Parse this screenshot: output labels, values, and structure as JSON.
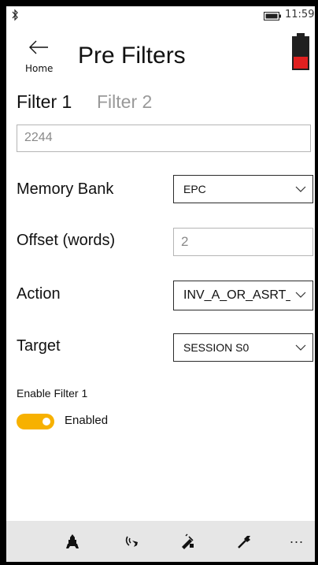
{
  "status_bar": {
    "time": "11:59",
    "icons": [
      "bluetooth-icon",
      "battery-icon"
    ]
  },
  "header": {
    "back_label": "Home",
    "back_icon": "back-arrow-icon",
    "title": "Pre Filters",
    "reader_battery": {
      "icon": "reader-battery-icon",
      "level": 0.3,
      "color": "#e02020"
    }
  },
  "tabs": [
    {
      "label": "Filter 1",
      "selected": true
    },
    {
      "label": "Filter 2",
      "selected": false
    }
  ],
  "filter": {
    "tag_mask_value": "2244",
    "memory_bank": {
      "label": "Memory Bank",
      "value": "EPC"
    },
    "offset": {
      "label": "Offset (words)",
      "value": "2"
    },
    "action": {
      "label": "Action",
      "value": "INV_A_OR_ASRT_SL"
    },
    "target": {
      "label": "Target",
      "value": "SESSION S0"
    },
    "enable": {
      "caption": "Enable Filter 1",
      "state_label": "Enabled",
      "on": true
    }
  },
  "app_bar": {
    "buttons": [
      "inventory-icon",
      "locate-icon",
      "access-icon",
      "settings-icon"
    ],
    "more_label": "..."
  },
  "colors": {
    "accent": "#f7b100",
    "app_bar_bg": "#e6e6e6",
    "battery_low": "#e02020"
  }
}
